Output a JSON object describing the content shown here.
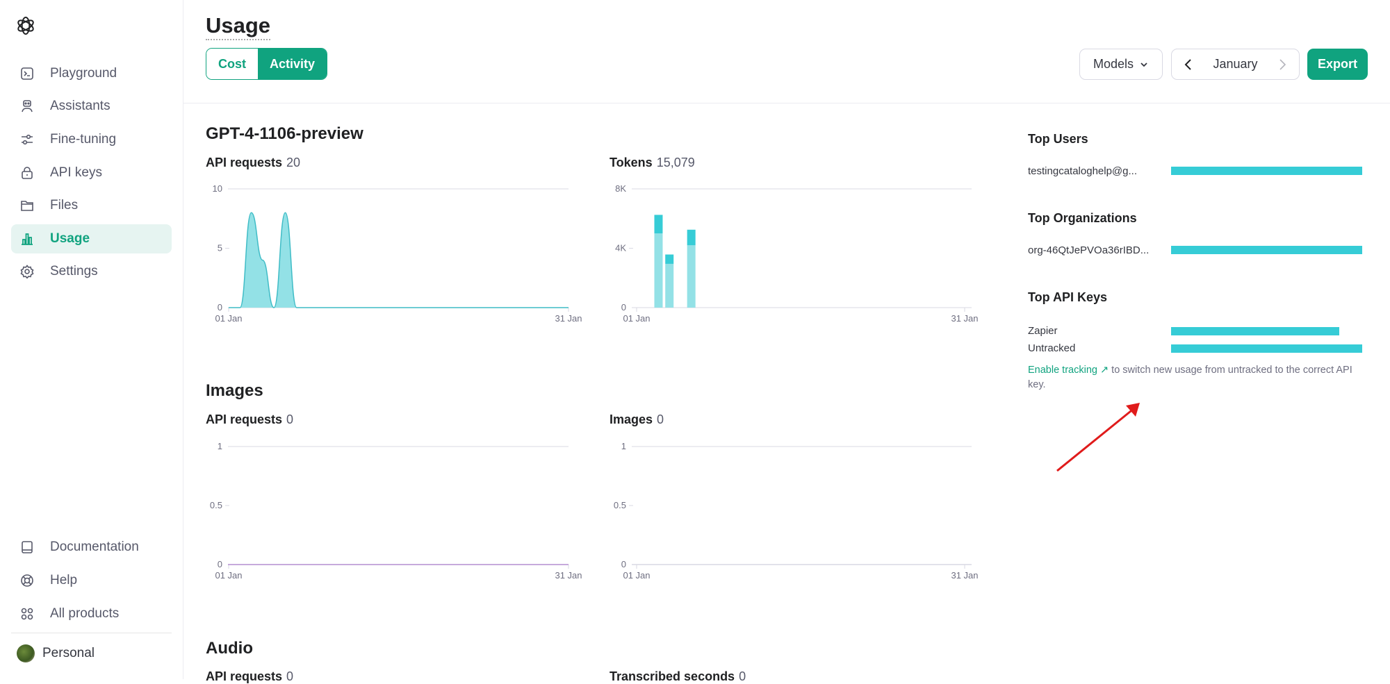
{
  "sidebar": {
    "items": [
      {
        "label": "Playground",
        "icon": "terminal-icon"
      },
      {
        "label": "Assistants",
        "icon": "robot-icon"
      },
      {
        "label": "Fine-tuning",
        "icon": "sliders-icon"
      },
      {
        "label": "API keys",
        "icon": "lock-icon"
      },
      {
        "label": "Files",
        "icon": "folder-icon"
      },
      {
        "label": "Usage",
        "icon": "bar-chart-icon",
        "active": true
      },
      {
        "label": "Settings",
        "icon": "gear-icon"
      }
    ],
    "bottom": [
      {
        "label": "Documentation",
        "icon": "book-icon"
      },
      {
        "label": "Help",
        "icon": "lifebuoy-icon"
      },
      {
        "label": "All products",
        "icon": "grid-icon"
      }
    ],
    "account": "Personal"
  },
  "header": {
    "title": "Usage",
    "tabs": [
      "Cost",
      "Activity"
    ],
    "active_tab": "Activity",
    "models_label": "Models",
    "month": "January",
    "export_label": "Export"
  },
  "colors": {
    "accent": "#10a37f",
    "bar": "#36ccd6",
    "bar_light": "#93e1e6",
    "image_line": "#b48ed0"
  },
  "sections": [
    {
      "title": "GPT-4-1106-preview",
      "left": {
        "label": "API requests",
        "value": "20"
      },
      "right": {
        "label": "Tokens",
        "value": "15,079"
      }
    },
    {
      "title": "Images",
      "left": {
        "label": "API requests",
        "value": "0"
      },
      "right": {
        "label": "Images",
        "value": "0"
      }
    },
    {
      "title": "Audio",
      "left": {
        "label": "API requests",
        "value": "0"
      },
      "right": {
        "label": "Transcribed seconds",
        "value": "0"
      }
    }
  ],
  "chart_data": [
    {
      "type": "area",
      "x_ticks": [
        "01 Jan",
        "31 Jan"
      ],
      "y_ticks": [
        "0",
        "5",
        "10"
      ],
      "ylim": [
        0,
        10
      ],
      "days": [
        1,
        2,
        3,
        4,
        5,
        6,
        7,
        31
      ],
      "values": [
        0,
        0,
        8,
        4,
        0,
        8,
        0,
        0
      ]
    },
    {
      "type": "bar",
      "stacked": true,
      "x_ticks": [
        "01 Jan",
        "31 Jan"
      ],
      "y_ticks": [
        "0",
        "4K",
        "8K"
      ],
      "ylim": [
        0,
        8000
      ],
      "days": [
        3,
        4,
        6
      ],
      "series": [
        {
          "values": [
            5000,
            2950,
            4200
          ]
        },
        {
          "values": [
            1250,
            629,
            1050
          ]
        }
      ]
    },
    {
      "type": "line",
      "x_ticks": [
        "01 Jan",
        "31 Jan"
      ],
      "y_ticks": [
        "0",
        "0.5",
        "1"
      ],
      "ylim": [
        0,
        1
      ],
      "values": [
        0
      ]
    },
    {
      "type": "line",
      "x_ticks": [
        "01 Jan",
        "31 Jan"
      ],
      "y_ticks": [
        "0",
        "0.5",
        "1"
      ],
      "ylim": [
        0,
        1
      ],
      "values": [
        0
      ]
    }
  ],
  "right_panel": {
    "top_users": {
      "title": "Top Users",
      "rows": [
        {
          "name": "testingcataloghelp@g...",
          "share": 1.0
        }
      ]
    },
    "top_orgs": {
      "title": "Top Organizations",
      "rows": [
        {
          "name": "org-46QtJePVOa36rIBD...",
          "share": 1.0
        }
      ]
    },
    "top_keys": {
      "title": "Top API Keys",
      "rows": [
        {
          "name": "Zapier",
          "share": 0.88
        },
        {
          "name": "Untracked",
          "share": 1.0
        }
      ]
    },
    "tracking_link": "Enable tracking",
    "tracking_text": "to switch new usage from untracked to the correct API key."
  }
}
